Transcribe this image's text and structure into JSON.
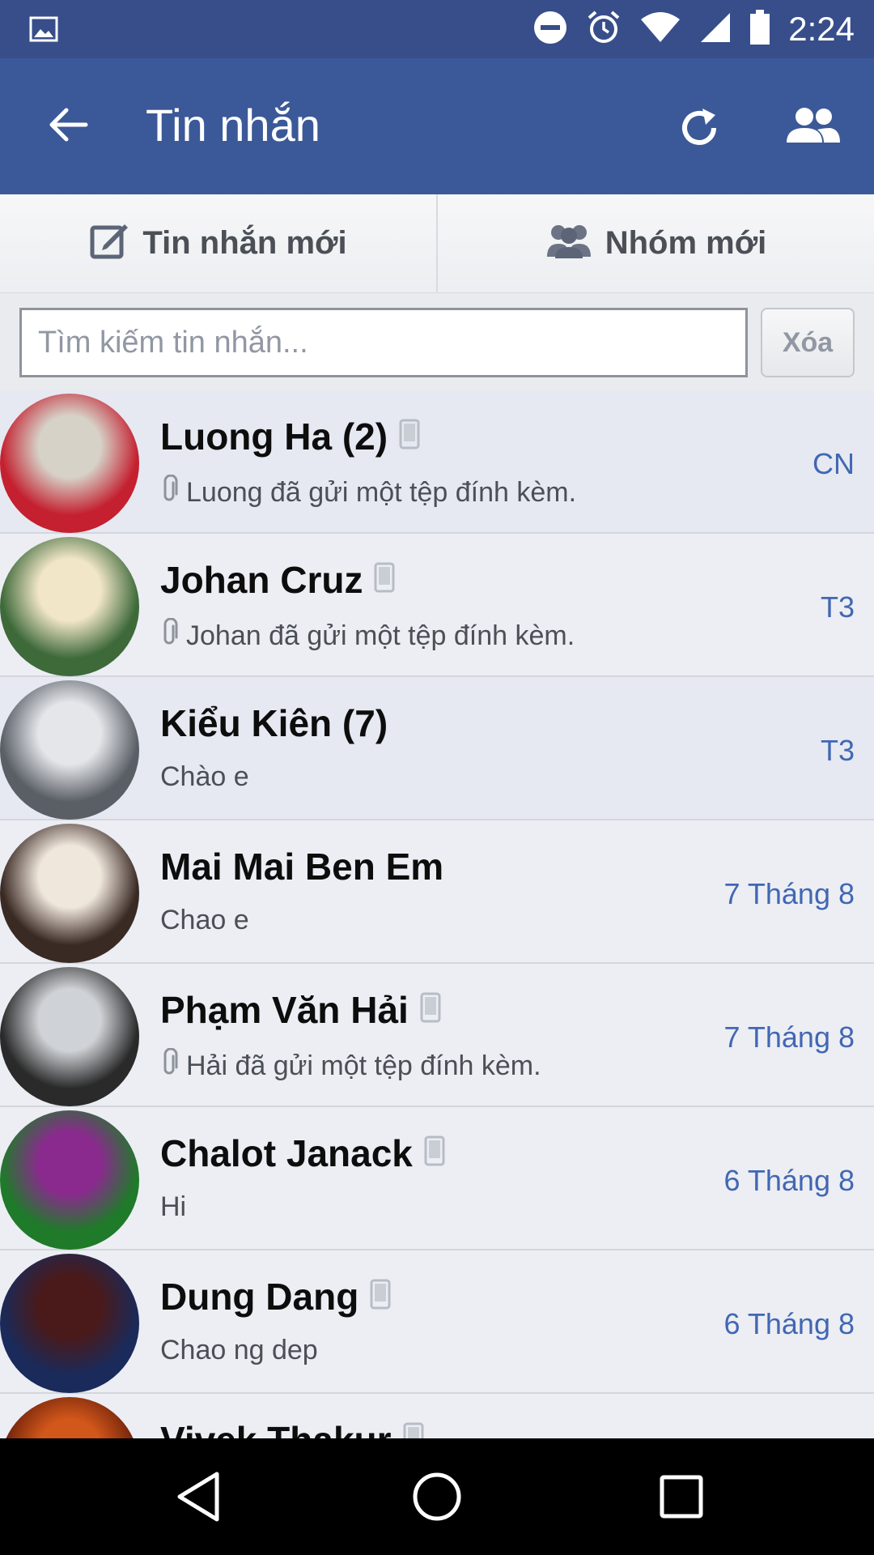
{
  "status_bar": {
    "time": "2:24",
    "icons": [
      "gallery-icon",
      "do-not-disturb-icon",
      "alarm-icon",
      "wifi-icon",
      "signal-icon",
      "battery-icon"
    ]
  },
  "app_bar": {
    "title": "Tin nhắn",
    "icons": [
      "back-arrow-icon",
      "refresh-icon",
      "people-icon"
    ]
  },
  "actions": {
    "new_message": "Tin nhắn mới",
    "new_group": "Nhóm mới"
  },
  "search": {
    "placeholder": "Tìm kiếm tin nhắn...",
    "clear_label": "Xóa"
  },
  "conversations": [
    {
      "name": "Luong Ha (2)",
      "snippet": "Luong đã gửi một tệp đính kèm.",
      "date": "CN",
      "mobile": true,
      "attachment": true,
      "unread": true,
      "avatar_colors": [
        "#d6d2c8",
        "#c4202f"
      ]
    },
    {
      "name": "Johan Cruz",
      "snippet": "Johan đã gửi một tệp đính kèm.",
      "date": "T3",
      "mobile": true,
      "attachment": true,
      "unread": false,
      "avatar_colors": [
        "#f2e6c8",
        "#3e6a3a"
      ]
    },
    {
      "name": "Kiểu Kiên (7)",
      "snippet": "Chào e",
      "date": "T3",
      "mobile": false,
      "attachment": false,
      "unread": true,
      "avatar_colors": [
        "#e4e6ea",
        "#5a5f66"
      ]
    },
    {
      "name": "Mai Mai Ben Em",
      "snippet": "Chao e",
      "date": "7 Tháng 8",
      "mobile": false,
      "attachment": false,
      "unread": false,
      "avatar_colors": [
        "#efe6dc",
        "#3a2a24"
      ]
    },
    {
      "name": "Phạm Văn Hải",
      "snippet": "Hải đã gửi một tệp đính kèm.",
      "date": "7 Tháng 8",
      "mobile": true,
      "attachment": true,
      "unread": false,
      "avatar_colors": [
        "#cfd2d6",
        "#2a2a2a"
      ]
    },
    {
      "name": "Chalot Janack",
      "snippet": "Hi",
      "date": "6 Tháng 8",
      "mobile": true,
      "attachment": false,
      "unread": false,
      "avatar_colors": [
        "#8a2a8e",
        "#1f7a2a"
      ]
    },
    {
      "name": "Dung Dang",
      "snippet": "Chao ng dep",
      "date": "6 Tháng 8",
      "mobile": true,
      "attachment": false,
      "unread": false,
      "avatar_colors": [
        "#4a1a1a",
        "#1a2a5a"
      ]
    },
    {
      "name": "Vivek Thakur",
      "snippet": "",
      "date": "",
      "mobile": true,
      "attachment": false,
      "unread": false,
      "avatar_colors": [
        "#d2571a",
        "#6a1f0a"
      ]
    }
  ],
  "nav_bar": {
    "icons": [
      "nav-back-icon",
      "nav-home-icon",
      "nav-recent-icon"
    ]
  }
}
